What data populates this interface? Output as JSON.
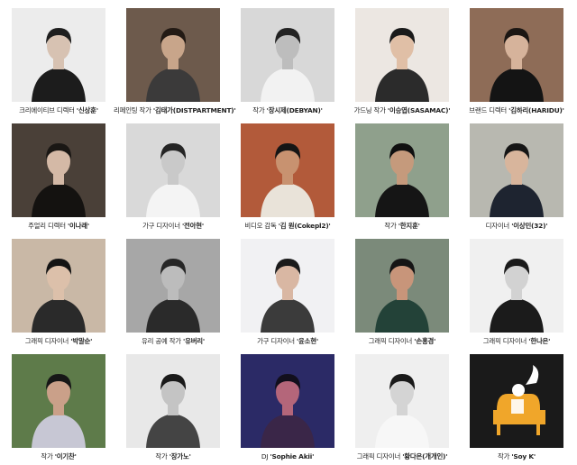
{
  "profiles": [
    {
      "role": "크리에이티브 디렉터",
      "name": "'신상훈'",
      "bg": "#ececec",
      "skin": "#d7c2b2",
      "hair": "#1e1e1e",
      "cloth": "#1c1c1c",
      "tone": "gray"
    },
    {
      "role": "리페인팅 작가",
      "name": "'김태가(DISTPARTMENT)'",
      "bg": "#6d5a4c",
      "skin": "#c8a58a",
      "hair": "#231a14",
      "cloth": "#3b3a3a",
      "tone": "color"
    },
    {
      "role": "작가",
      "name": "'장시제(DEBYAN)'",
      "bg": "#d8d8d8",
      "skin": "#bdbdbd",
      "hair": "#222222",
      "cloth": "#f2f2f2",
      "tone": "gray"
    },
    {
      "role": "가드닝 작가",
      "name": "'이승엽(SASAMAC)'",
      "bg": "#ece7e2",
      "skin": "#e0bfa6",
      "hair": "#1a1a1a",
      "cloth": "#2b2b2b",
      "tone": "color"
    },
    {
      "role": "브랜드 디렉터",
      "name": "'김하리(HARIDU)'",
      "bg": "#8e6c57",
      "skin": "#d6b39b",
      "hair": "#1b1613",
      "cloth": "#141414",
      "tone": "color"
    },
    {
      "role": "주얼리 디렉터",
      "name": "'이나래'",
      "bg": "#4a4038",
      "skin": "#d4b9a6",
      "hair": "#1a1714",
      "cloth": "#141210",
      "tone": "color"
    },
    {
      "role": "가구 디자이너",
      "name": "'전아현'",
      "bg": "#d9d9d9",
      "skin": "#c9c9c9",
      "hair": "#252525",
      "cloth": "#f4f4f4",
      "tone": "gray"
    },
    {
      "role": "비디오 감독",
      "name": "'김 원(Cokepl2)'",
      "bg": "#b25a3a",
      "skin": "#c89270",
      "hair": "#151515",
      "cloth": "#e9e3d9",
      "tone": "color"
    },
    {
      "role": "작가",
      "name": "'한지훈'",
      "bg": "#8fa08c",
      "skin": "#c59a7c",
      "hair": "#101010",
      "cloth": "#151515",
      "tone": "color"
    },
    {
      "role": "디자이너",
      "name": "'이상민(32)'",
      "bg": "#b8b8b0",
      "skin": "#d8b59c",
      "hair": "#151515",
      "cloth": "#1e2430",
      "tone": "color"
    },
    {
      "role": "그래픽 디자이너",
      "name": "'박말순'",
      "bg": "#c9b8a6",
      "skin": "#dcc0aa",
      "hair": "#141414",
      "cloth": "#2a2a2a",
      "tone": "color"
    },
    {
      "role": "유리 공예 작가",
      "name": "'유버리'",
      "bg": "#a7a7a7",
      "skin": "#bcbcbc",
      "hair": "#262626",
      "cloth": "#2a2a2a",
      "tone": "gray"
    },
    {
      "role": "가구 디자이너",
      "name": "'윤소현'",
      "bg": "#f1f1f3",
      "skin": "#d9b7a3",
      "hair": "#1b1b1b",
      "cloth": "#3b3b3b",
      "tone": "color"
    },
    {
      "role": "그래픽 디자이너",
      "name": "'손홍경'",
      "bg": "#7b8a7a",
      "skin": "#c8957a",
      "hair": "#151515",
      "cloth": "#234238",
      "tone": "color"
    },
    {
      "role": "그래픽 디자이너",
      "name": "'한나은'",
      "bg": "#f0f0f0",
      "skin": "#d2d2d2",
      "hair": "#1a1a1a",
      "cloth": "#1b1b1b",
      "tone": "gray"
    },
    {
      "role": "작가",
      "name": "'이기찬'",
      "bg": "#5e7b4a",
      "skin": "#caa089",
      "hair": "#171717",
      "cloth": "#c7c7d4",
      "tone": "color"
    },
    {
      "role": "작가",
      "name": "'장가노'",
      "bg": "#e8e8e8",
      "skin": "#c4c4c4",
      "hair": "#1a1a1a",
      "cloth": "#444444",
      "tone": "gray"
    },
    {
      "role": "DJ",
      "name": "'Sophie Akii'",
      "bg": "#2b2a66",
      "skin": "#b4667a",
      "hair": "#120f1c",
      "cloth": "#3a2648",
      "tone": "color"
    },
    {
      "role": "그래픽 디자이너",
      "name": "'황다은(개개인)'",
      "bg": "#efefef",
      "skin": "#d4d4d4",
      "hair": "#1a1a1a",
      "cloth": "#f7f7f7",
      "tone": "gray"
    },
    {
      "role": "작가",
      "name": "'Soy K'",
      "bg": "#1a1a1a",
      "skin": "#f0a62a",
      "hair": "#f0a62a",
      "cloth": "#f0a62a",
      "tone": "illustration"
    }
  ]
}
